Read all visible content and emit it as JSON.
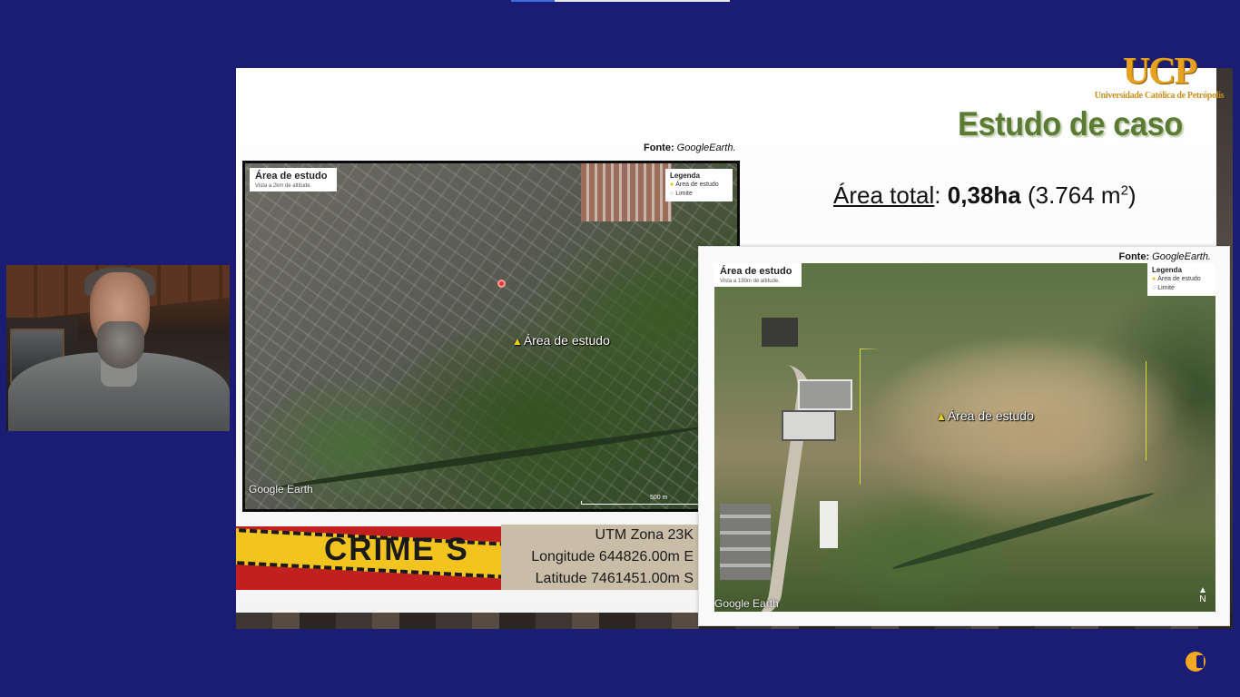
{
  "logo": {
    "mark": "UCP",
    "subtitle": "Universidade Católica de Petrópolis"
  },
  "slide": {
    "title": "Estudo de caso",
    "area_total": {
      "label": "Área total",
      "separator": ":",
      "value": "0,38ha",
      "detail_open": "(3.764 m",
      "detail_sup": "2",
      "detail_close": ")"
    },
    "map1": {
      "source_label": "Fonte:",
      "source_name": "GoogleEarth.",
      "badge_title": "Área de estudo",
      "badge_subtitle": "Vista a 2km de altitude.",
      "legend_title": "Legenda",
      "legend_item_1": "Área de estudo",
      "legend_item_2": "Limite",
      "place_label": "Área de estudo",
      "watermark": "Google Earth",
      "scale": "500 m"
    },
    "map2": {
      "source_label": "Fonte:",
      "source_name": "GoogleEarth.",
      "badge_title": "Área de estudo",
      "badge_subtitle": "Vista a 130m de altitude.",
      "legend_title": "Legenda",
      "legend_item_1": "Área de estudo",
      "legend_item_2": "Limite",
      "place_label": "Área de estudo",
      "watermark": "Google Earth",
      "north": "N"
    },
    "crime_banner": {
      "word": "CRIME S",
      "utm_zone": "UTM Zona 23K",
      "longitude": "Longitude 644826.00m E",
      "latitude": "Latitude 7461451.00m S"
    }
  },
  "colors": {
    "background": "#1b1c74",
    "title_green": "#5b7a33",
    "logo_gold": "#e6a21e",
    "crime_yellow": "#f2c41d",
    "crime_red": "#c21f1f"
  },
  "icons": {
    "pin": "map-pin-icon",
    "north": "north-arrow-icon",
    "app": "app-logo-icon"
  }
}
